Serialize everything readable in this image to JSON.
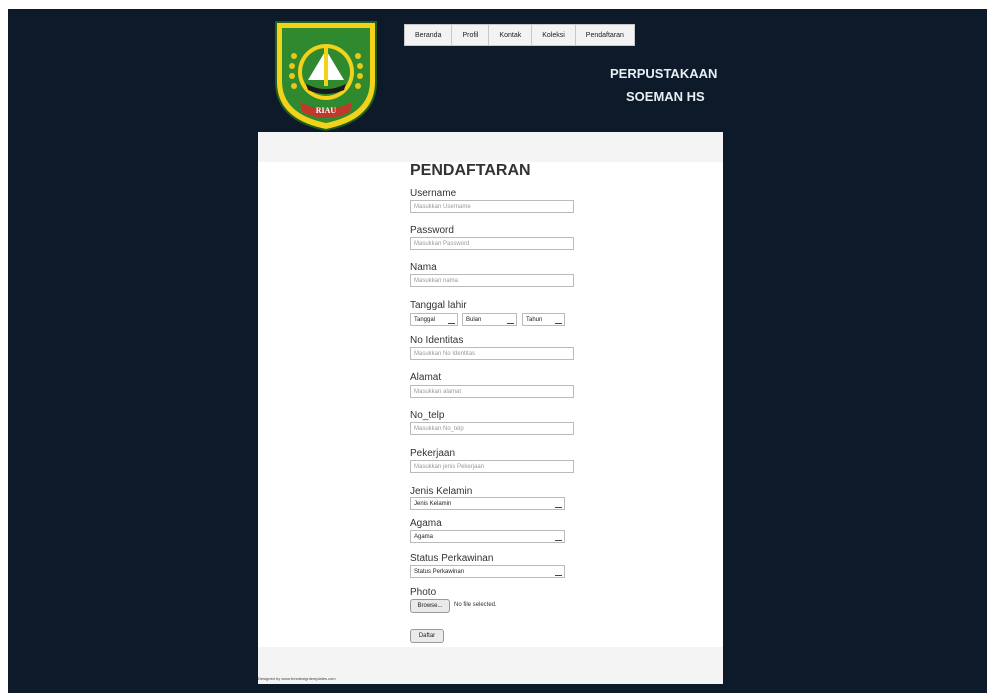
{
  "nav": {
    "items": [
      "Beranda",
      "Profil",
      "Kontak",
      "Koleksi",
      "Pendaftaran"
    ]
  },
  "site": {
    "title_line1": "PERPUSTAKAAN",
    "title_line2": "SOEMAN HS",
    "logo_text": "RIAU"
  },
  "form": {
    "heading": "PENDAFTARAN",
    "username": {
      "label": "Username",
      "placeholder": "Masukkan Username"
    },
    "password": {
      "label": "Password",
      "placeholder": "Masukkan Password"
    },
    "nama": {
      "label": "Nama",
      "placeholder": "Masukkan nama"
    },
    "tanggal_lahir": {
      "label": "Tanggal lahir",
      "day": "Tanggal",
      "month": "Bulan",
      "year": "Tahun"
    },
    "no_identitas": {
      "label": "No Identitas",
      "placeholder": "Masukkan No Identitas"
    },
    "alamat": {
      "label": "Alamat",
      "placeholder": "Masukkan alamat"
    },
    "no_telp": {
      "label": "No_telp",
      "placeholder": "Masukkan No_telp"
    },
    "pekerjaan": {
      "label": "Pekerjaan",
      "placeholder": "Masukkan jenis Pekerjaan"
    },
    "jenis_kelamin": {
      "label": "Jenis Kelamin",
      "value": "Jenis Kelamin"
    },
    "agama": {
      "label": "Agama",
      "value": "Agama"
    },
    "status_perkawinan": {
      "label": "Status Perkawinan",
      "value": "Status Perkawinan"
    },
    "photo": {
      "label": "Photo",
      "browse": "Browse...",
      "status": "No file selected."
    },
    "submit": "Daftar"
  },
  "footer": {
    "credit": "Designed by www.freedesigntemplates.com"
  },
  "colors": {
    "background": "#0d1a29",
    "logo_green": "#2f8a2f",
    "logo_yellow": "#f2d21b"
  }
}
